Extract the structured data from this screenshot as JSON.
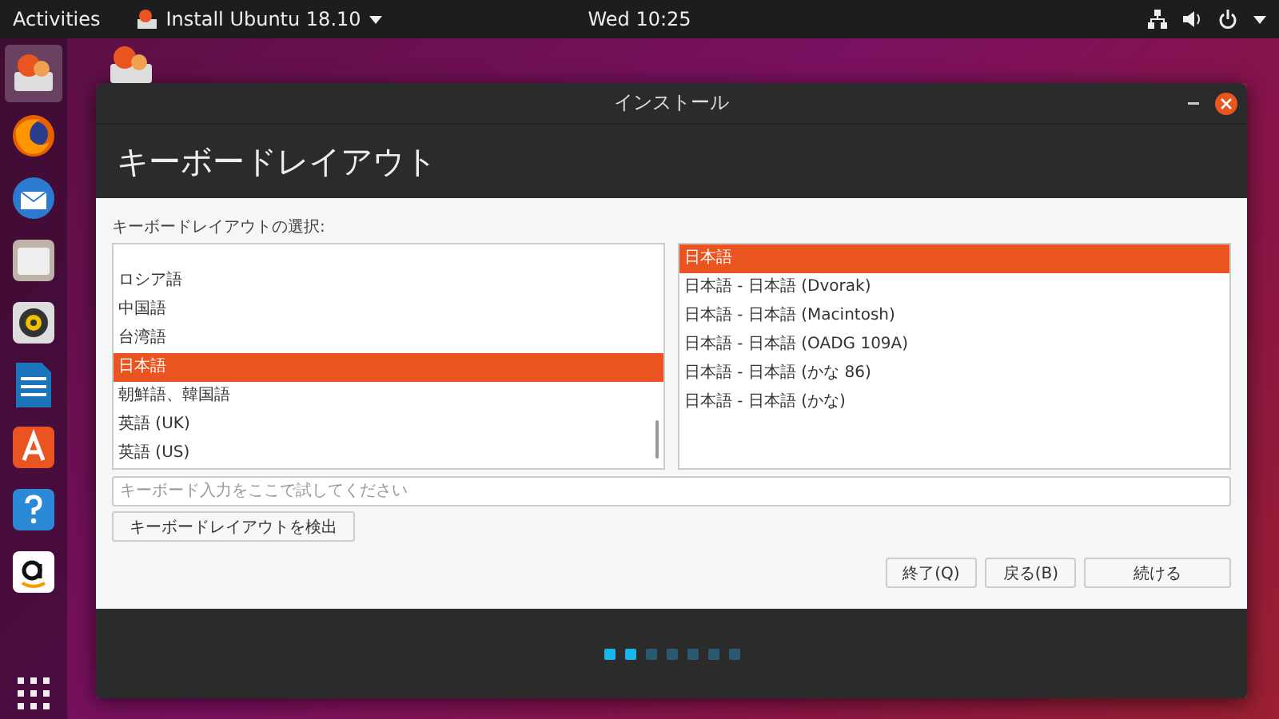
{
  "top_bar": {
    "activities": "Activities",
    "app_menu": "Install Ubuntu 18.10",
    "clock": "Wed 10:25"
  },
  "dock": {
    "items": [
      {
        "kind": "installer",
        "selected": true
      },
      {
        "kind": "firefox",
        "selected": false
      },
      {
        "kind": "mail",
        "selected": false
      },
      {
        "kind": "files",
        "selected": false
      },
      {
        "kind": "music",
        "selected": false
      },
      {
        "kind": "writer",
        "selected": false
      },
      {
        "kind": "software",
        "selected": false
      },
      {
        "kind": "help",
        "selected": false
      },
      {
        "kind": "amazon",
        "selected": false
      }
    ]
  },
  "window": {
    "title": "インストール",
    "heading": "キーボードレイアウト",
    "layout_label": "キーボードレイアウトの選択:",
    "layouts": [
      {
        "label": "ロシア語",
        "selected": false
      },
      {
        "label": "中国語",
        "selected": false
      },
      {
        "label": "台湾語",
        "selected": false
      },
      {
        "label": "日本語",
        "selected": true
      },
      {
        "label": "朝鮮語、韓国語",
        "selected": false
      },
      {
        "label": "英語 (UK)",
        "selected": false
      },
      {
        "label": "英語 (US)",
        "selected": false
      }
    ],
    "variants": [
      {
        "label": "日本語",
        "selected": true
      },
      {
        "label": "日本語 - 日本語 (Dvorak)",
        "selected": false
      },
      {
        "label": "日本語 - 日本語 (Macintosh)",
        "selected": false
      },
      {
        "label": "日本語 - 日本語 (OADG 109A)",
        "selected": false
      },
      {
        "label": "日本語 - 日本語 (かな 86)",
        "selected": false
      },
      {
        "label": "日本語 - 日本語 (かな)",
        "selected": false
      }
    ],
    "test_field": {
      "placeholder": "キーボード入力をここで試してください"
    },
    "detect_button": "キーボードレイアウトを検出",
    "buttons": [
      "終了(Q)",
      "戻る(B)",
      "続ける"
    ],
    "steps": [
      {
        "done": true
      },
      {
        "done": true
      },
      {
        "done": false
      },
      {
        "done": false
      },
      {
        "done": false
      },
      {
        "done": false
      },
      {
        "done": false
      }
    ]
  }
}
